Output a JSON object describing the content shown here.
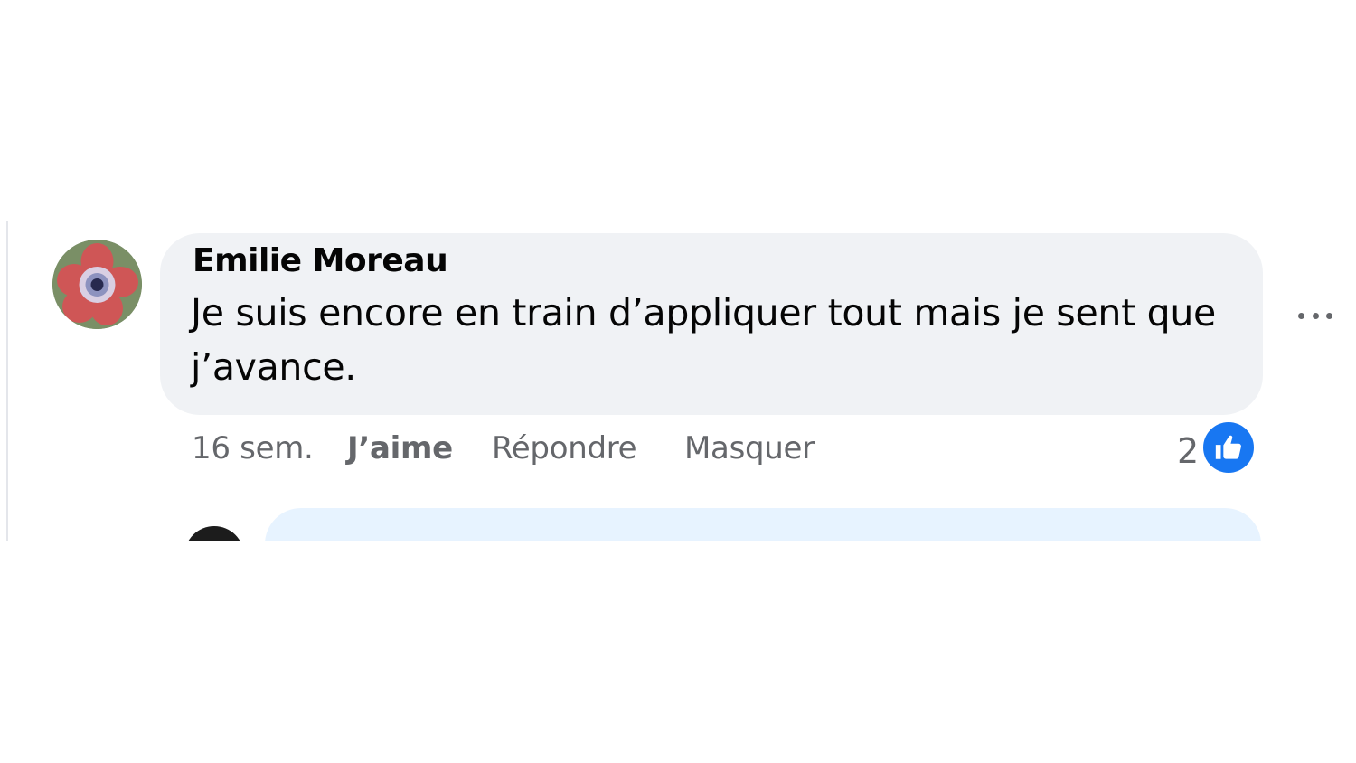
{
  "comment": {
    "author": "Emilie Moreau",
    "text": "Je suis encore en train d’appliquer tout mais je sent que j’avance.",
    "avatar_icon": "flower-avatar",
    "more_icon": "more-options-icon"
  },
  "actions": {
    "timestamp": "16 sem.",
    "like_label": "J’aime",
    "reply_label": "Répondre",
    "hide_label": "Masquer"
  },
  "reactions": {
    "count": "2",
    "icon": "thumbs-up-icon"
  },
  "colors": {
    "bubble": "#f0f2f5",
    "reply_box": "#e7f3ff",
    "like_badge": "#1877f2",
    "secondary_text": "#65676b"
  }
}
